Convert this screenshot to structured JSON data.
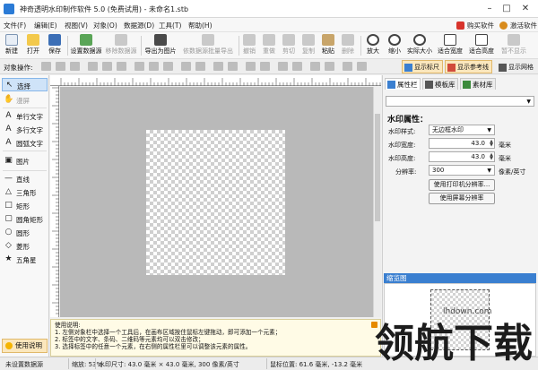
{
  "window": {
    "title": "神奇透明水印制作软件 5.0 (免费试用) - 未命名1.stb"
  },
  "menu": [
    "文件(F)",
    "编辑(E)",
    "视图(V)",
    "对象(O)",
    "数据源(D)",
    "工具(T)",
    "帮助(H)"
  ],
  "menu_right": {
    "buy": "购买软件",
    "activate": "激活软件"
  },
  "toolbar": {
    "new": "新建",
    "open": "打开",
    "save": "保存",
    "set_ds": "设置数据源",
    "rm_ds": "移除数据源",
    "export_img": "导出为图片",
    "batch_export": "依数据源批量导出",
    "undo": "撤销",
    "redo": "重做",
    "cut": "剪切",
    "copy": "复制",
    "paste": "粘贴",
    "delete": "删除",
    "zoom_in": "放大",
    "zoom_out": "缩小",
    "actual": "实际大小",
    "fit_w": "适合宽度",
    "fit_h": "适合高度",
    "hide": "暂不显示"
  },
  "objbar": {
    "label": "对象操作:",
    "show_ruler": "显示标尺",
    "show_guides": "显示参考线",
    "show_grid": "显示网格"
  },
  "tools": [
    {
      "label": "选择",
      "icon": "arrow-icon",
      "glyph": "↖"
    },
    {
      "label": "漫屏",
      "icon": "hand-icon",
      "glyph": "✋"
    },
    {
      "label": "单行文字",
      "icon": "text-icon",
      "glyph": "A"
    },
    {
      "label": "多行文字",
      "icon": "multiline-text-icon",
      "glyph": "A"
    },
    {
      "label": "圆弧文字",
      "icon": "arc-text-icon",
      "glyph": "A"
    },
    {
      "label": "图片",
      "icon": "image-icon",
      "glyph": "▣"
    },
    {
      "label": "直线",
      "icon": "line-icon",
      "glyph": "—"
    },
    {
      "label": "三角形",
      "icon": "triangle-icon",
      "glyph": "△"
    },
    {
      "label": "矩形",
      "icon": "rectangle-icon",
      "glyph": "□"
    },
    {
      "label": "圆角矩形",
      "icon": "rounded-rect-icon",
      "glyph": "▢"
    },
    {
      "label": "圆形",
      "icon": "circle-icon",
      "glyph": "○"
    },
    {
      "label": "菱形",
      "icon": "diamond-icon",
      "glyph": "◇"
    },
    {
      "label": "五角星",
      "icon": "star-icon",
      "glyph": "★"
    }
  ],
  "help_btn": "使用说明",
  "instructions": {
    "title": "使用说明:",
    "lines": [
      "1. 左侧对象栏中选择一个工具后，在画布区域按住鼠标左键拖动，即可添加一个元素；",
      "2. 标签中的文字、条码、二维码等元素均可以双击修改；",
      "3. 选择标签中的任意一个元素，在右侧的属性栏里可以调整该元素的属性。"
    ]
  },
  "right_tabs": [
    "属性栏",
    "模板库",
    "素材库"
  ],
  "properties": {
    "section": "水印属性：",
    "style_label": "水印样式:",
    "style_value": "无边框水印",
    "width_label": "水印宽度:",
    "width_value": "43.0",
    "width_unit": "毫米",
    "height_label": "水印高度:",
    "height_value": "43.0",
    "height_unit": "毫米",
    "dpi_label": "分辨率:",
    "dpi_value": "300",
    "dpi_unit": "像素/英寸",
    "btn_printer": "使用打印机分辨率...",
    "btn_screen": "使用屏幕分辨率"
  },
  "preview": {
    "title": "缩览图"
  },
  "status": {
    "ds": "未设置数据源",
    "zoom": "缩放: 53%",
    "size": "水印尺寸: 43.0 毫米 × 43.0 毫米, 300 像素/英寸",
    "cursor": "鼠标位置: 61.6 毫米, -13.2 毫米"
  },
  "watermark": {
    "site": "lhdown.com",
    "brand": "领航下载"
  }
}
